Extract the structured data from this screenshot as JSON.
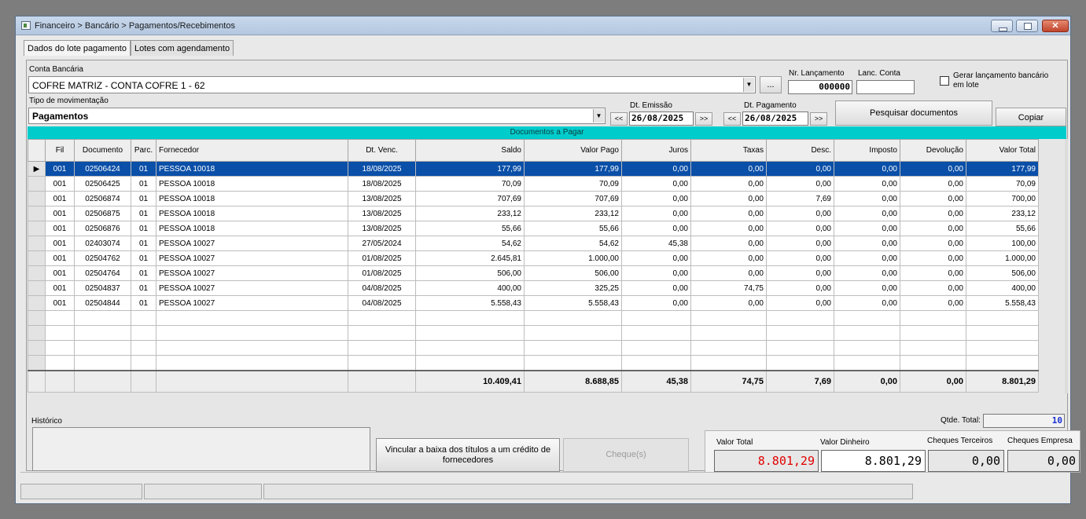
{
  "window": {
    "title": "Financeiro > Bancário > Pagamentos/Recebimentos",
    "close_glyph": "✕"
  },
  "tabs": [
    {
      "label": "Dados do lote pagamento"
    },
    {
      "label": "Lotes com agendamento"
    }
  ],
  "form": {
    "conta_label": "Conta Bancária",
    "conta_value": "COFRE MATRIZ - CONTA COFRE 1 - 62",
    "ellipsis": "...",
    "nr_lanc_label": "Nr. Lançamento",
    "nr_lanc_value": "000000",
    "lanc_conta_label": "Lanc. Conta",
    "lanc_conta_value": "",
    "gerar_label": "Gerar lançamento bancário em lote",
    "tipo_label": "Tipo de movimentação",
    "tipo_value": "Pagamentos",
    "prev": "<<",
    "next": ">>",
    "dt_emissao_label": "Dt. Emissão",
    "dt_emissao_value": "26/08/2025",
    "dt_pagamento_label": "Dt. Pagamento",
    "dt_pagamento_value": "26/08/2025",
    "pesquisar_label": "Pesquisar documentos",
    "copiar_label": "Copiar"
  },
  "grid": {
    "title": "Documentos a Pagar",
    "columns": [
      "Fil",
      "Documento",
      "Parc.",
      "Fornecedor",
      "Dt. Venc.",
      "Saldo",
      "Valor Pago",
      "Juros",
      "Taxas",
      "Desc.",
      "Imposto",
      "Devolução",
      "Valor Total"
    ],
    "rows": [
      [
        "001",
        "02506424",
        "01",
        "PESSOA 10018",
        "18/08/2025",
        "177,99",
        "177,99",
        "0,00",
        "0,00",
        "0,00",
        "0,00",
        "0,00",
        "177,99"
      ],
      [
        "001",
        "02506425",
        "01",
        "PESSOA 10018",
        "18/08/2025",
        "70,09",
        "70,09",
        "0,00",
        "0,00",
        "0,00",
        "0,00",
        "0,00",
        "70,09"
      ],
      [
        "001",
        "02506874",
        "01",
        "PESSOA 10018",
        "13/08/2025",
        "707,69",
        "707,69",
        "0,00",
        "0,00",
        "7,69",
        "0,00",
        "0,00",
        "700,00"
      ],
      [
        "001",
        "02506875",
        "01",
        "PESSOA 10018",
        "13/08/2025",
        "233,12",
        "233,12",
        "0,00",
        "0,00",
        "0,00",
        "0,00",
        "0,00",
        "233,12"
      ],
      [
        "001",
        "02506876",
        "01",
        "PESSOA 10018",
        "13/08/2025",
        "55,66",
        "55,66",
        "0,00",
        "0,00",
        "0,00",
        "0,00",
        "0,00",
        "55,66"
      ],
      [
        "001",
        "02403074",
        "01",
        "PESSOA 10027",
        "27/05/2024",
        "54,62",
        "54,62",
        "45,38",
        "0,00",
        "0,00",
        "0,00",
        "0,00",
        "100,00"
      ],
      [
        "001",
        "02504762",
        "01",
        "PESSOA 10027",
        "01/08/2025",
        "2.645,81",
        "1.000,00",
        "0,00",
        "0,00",
        "0,00",
        "0,00",
        "0,00",
        "1.000,00"
      ],
      [
        "001",
        "02504764",
        "01",
        "PESSOA 10027",
        "01/08/2025",
        "506,00",
        "506,00",
        "0,00",
        "0,00",
        "0,00",
        "0,00",
        "0,00",
        "506,00"
      ],
      [
        "001",
        "02504837",
        "01",
        "PESSOA 10027",
        "04/08/2025",
        "400,00",
        "325,25",
        "0,00",
        "74,75",
        "0,00",
        "0,00",
        "0,00",
        "400,00"
      ],
      [
        "001",
        "02504844",
        "01",
        "PESSOA 10027",
        "04/08/2025",
        "5.558,43",
        "5.558,43",
        "0,00",
        "0,00",
        "0,00",
        "0,00",
        "0,00",
        "5.558,43"
      ]
    ],
    "selected_row": 0,
    "row_pointer": "▶",
    "empty_rows": 4,
    "totals": [
      "10.409,41",
      "8.688,85",
      "45,38",
      "74,75",
      "7,69",
      "0,00",
      "0,00",
      "8.801,29"
    ]
  },
  "bottom": {
    "historico_label": "Histórico",
    "qtde_label": "Qtde. Total:",
    "qtde_value": "10",
    "vincular_label": "Vincular a baixa dos títulos a um crédito de fornecedores",
    "cheques_label": "Cheque(s)",
    "valor_total_label": "Valor Total",
    "valor_total_value": "8.801,29",
    "valor_dinheiro_label": "Valor Dinheiro",
    "valor_dinheiro_value": "8.801,29",
    "cheques_terceiros_label": "Cheques Terceiros",
    "cheques_terceiros_value": "0,00",
    "cheques_empresa_label": "Cheques Empresa",
    "cheques_empresa_value": "0,00"
  },
  "colors": {
    "selection": "#0a4fa8",
    "header_bar": "#00cccc",
    "total_red": "#e00000",
    "qtde_blue": "#1a2fd0"
  }
}
